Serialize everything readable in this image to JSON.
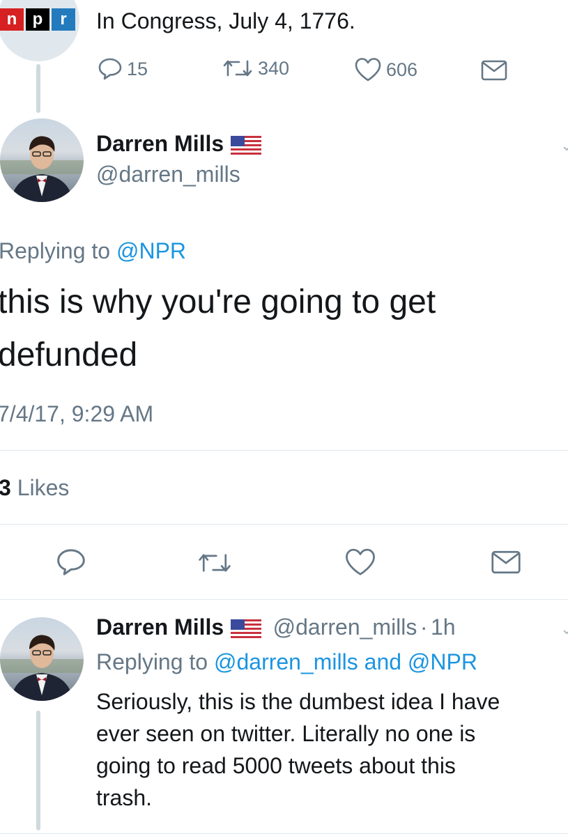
{
  "top_tweet": {
    "logo_letters": [
      "n",
      "p",
      "r"
    ],
    "text": "In Congress, July 4, 1776.",
    "replies": "15",
    "retweets": "340",
    "likes": "606",
    "colors": {
      "npr_red": "#d62021",
      "npr_black": "#000000",
      "npr_blue": "#237bbd"
    }
  },
  "main_tweet": {
    "name": "Darren Mills",
    "handle": "@darren_mills",
    "replying_label": "Replying to",
    "replying_to": "@NPR",
    "text_line1": "this is why you're going to get",
    "text_line2": "defunded",
    "timestamp": "7/4/17, 9:29 AM",
    "likes_count": "3",
    "likes_label": "Likes"
  },
  "reply_tweet": {
    "name": "Darren Mills",
    "handle": "@darren_mills",
    "separator": "·",
    "age": "1h",
    "replying_label": "Replying to",
    "replying_to": "@darren_mills and @NPR",
    "lines": [
      "Seriously, this is the dumbest idea I have",
      "ever seen on twitter. Literally no one is",
      "going to read 5000 tweets about this",
      "trash."
    ]
  },
  "icons": [
    "reply-icon",
    "retweet-icon",
    "like-icon",
    "dm-icon",
    "us-flag-icon",
    "chevron-down-icon"
  ],
  "colors": {
    "link": "#1b95e0",
    "muted": "#657786",
    "text": "#14171a",
    "divider": "#e1e8ed"
  }
}
